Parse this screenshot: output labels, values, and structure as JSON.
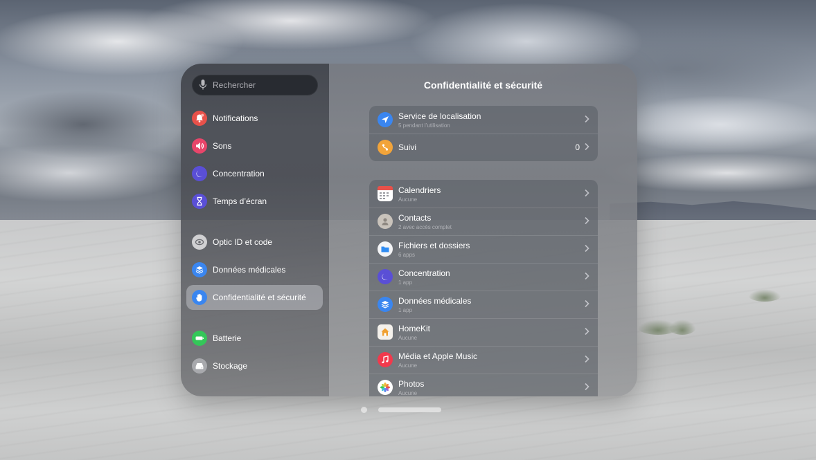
{
  "search": {
    "placeholder": "Rechercher"
  },
  "sidebar": {
    "items": [
      {
        "label": "Notifications",
        "icon": "bell-icon",
        "color": "#e8514a"
      },
      {
        "label": "Sons",
        "icon": "speaker-icon",
        "color": "#e8456a"
      },
      {
        "label": "Concentration",
        "icon": "moon-icon",
        "color": "#5a4fd6"
      },
      {
        "label": "Temps d’écran",
        "icon": "hourglass-icon",
        "color": "#5a4fd6"
      },
      {
        "label": "Optic ID et code",
        "icon": "eye-icon",
        "color": "#d0d0d2"
      },
      {
        "label": "Données médicales",
        "icon": "stack-icon",
        "color": "#3a86f0"
      },
      {
        "label": "Confidentialité et sécurité",
        "icon": "hand-icon",
        "color": "#3a86f0",
        "active": true
      },
      {
        "label": "Batterie",
        "icon": "battery-icon",
        "color": "#34c759"
      },
      {
        "label": "Stockage",
        "icon": "drive-icon",
        "color": "#a8a9ad"
      }
    ]
  },
  "main": {
    "title": "Confidentialité et sécurité",
    "group1": [
      {
        "title": "Service de localisation",
        "subtitle": "5 pendant l’utilisation",
        "icon": "location-arrow-icon",
        "color": "#3a86f0"
      },
      {
        "title": "Suivi",
        "value": "0",
        "icon": "tracking-icon",
        "color": "#f2a43a"
      }
    ],
    "group2": [
      {
        "title": "Calendriers",
        "subtitle": "Aucune",
        "icon": "calendar-icon"
      },
      {
        "title": "Contacts",
        "subtitle": "2 avec accès complet",
        "icon": "contacts-icon"
      },
      {
        "title": "Fichiers et dossiers",
        "subtitle": "6 apps",
        "icon": "folder-icon"
      },
      {
        "title": "Concentration",
        "subtitle": "1 app",
        "icon": "moon-icon"
      },
      {
        "title": "Données médicales",
        "subtitle": "1 app",
        "icon": "stack-icon"
      },
      {
        "title": "HomeKit",
        "subtitle": "Aucune",
        "icon": "home-icon"
      },
      {
        "title": "Média et Apple Music",
        "subtitle": "Aucune",
        "icon": "music-note-icon"
      },
      {
        "title": "Photos",
        "subtitle": "Aucune",
        "icon": "photos-icon"
      }
    ]
  }
}
